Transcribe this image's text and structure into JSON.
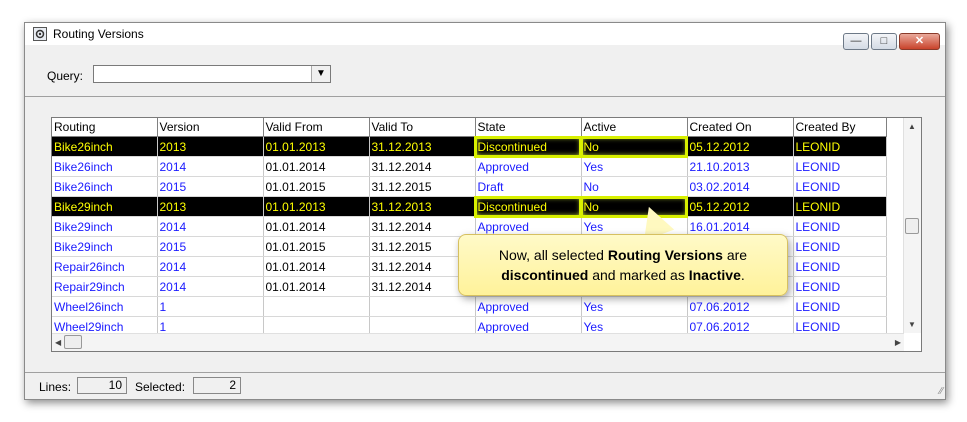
{
  "window": {
    "title": "Routing Versions"
  },
  "query": {
    "label": "Query:",
    "value": ""
  },
  "table": {
    "columns": [
      "Routing",
      "Version",
      "Valid From",
      "Valid To",
      "State",
      "Active",
      "Created On",
      "Created By"
    ],
    "rows": [
      {
        "selected": true,
        "cells": [
          "Bike26inch",
          "2013",
          "01.01.2013",
          "31.12.2013",
          "Discontinued",
          "No",
          "05.12.2012",
          "LEONID"
        ]
      },
      {
        "selected": false,
        "cells": [
          "Bike26inch",
          "2014",
          "01.01.2014",
          "31.12.2014",
          "Approved",
          "Yes",
          "21.10.2013",
          "LEONID"
        ]
      },
      {
        "selected": false,
        "cells": [
          "Bike26inch",
          "2015",
          "01.01.2015",
          "31.12.2015",
          "Draft",
          "No",
          "03.02.2014",
          "LEONID"
        ]
      },
      {
        "selected": true,
        "cells": [
          "Bike29inch",
          "2013",
          "01.01.2013",
          "31.12.2013",
          "Discontinued",
          "No",
          "05.12.2012",
          "LEONID"
        ]
      },
      {
        "selected": false,
        "cells": [
          "Bike29inch",
          "2014",
          "01.01.2014",
          "31.12.2014",
          "Approved",
          "Yes",
          "16.01.2014",
          "LEONID"
        ]
      },
      {
        "selected": false,
        "cells": [
          "Bike29inch",
          "2015",
          "01.01.2015",
          "31.12.2015",
          "",
          "",
          "",
          "LEONID"
        ]
      },
      {
        "selected": false,
        "cells": [
          "Repair26inch",
          "2014",
          "01.01.2014",
          "31.12.2014",
          "",
          "",
          "",
          "LEONID"
        ]
      },
      {
        "selected": false,
        "cells": [
          "Repair29inch",
          "2014",
          "01.01.2014",
          "31.12.2014",
          "",
          "",
          "",
          "LEONID"
        ]
      },
      {
        "selected": false,
        "cells": [
          "Wheel26inch",
          "1",
          "",
          "",
          "Approved",
          "Yes",
          "07.06.2012",
          "LEONID"
        ]
      },
      {
        "selected": false,
        "cells": [
          "Wheel29inch",
          "1",
          "",
          "",
          "Approved",
          "Yes",
          "07.06.2012",
          "LEONID"
        ]
      }
    ]
  },
  "status": {
    "lines_label": "Lines:",
    "lines_value": "10",
    "selected_label": "Selected:",
    "selected_value": "2"
  },
  "callout": {
    "part1": "Now, all selected ",
    "bold1": "Routing Versions",
    "part2": " are",
    "bold2": "discontinued",
    "part3": " and marked as ",
    "bold3": "Inactive",
    "part4": "."
  },
  "icons": {
    "app": "routing-gear-icon",
    "minimize": "minimize-icon",
    "maximize": "maximize-icon",
    "close": "close-icon"
  },
  "colors": {
    "selection_bg": "#000000",
    "selection_text": "#ffff00",
    "link_text": "#1a1aff",
    "highlight": "#d8f000",
    "callout_bg": "#fff29a"
  }
}
